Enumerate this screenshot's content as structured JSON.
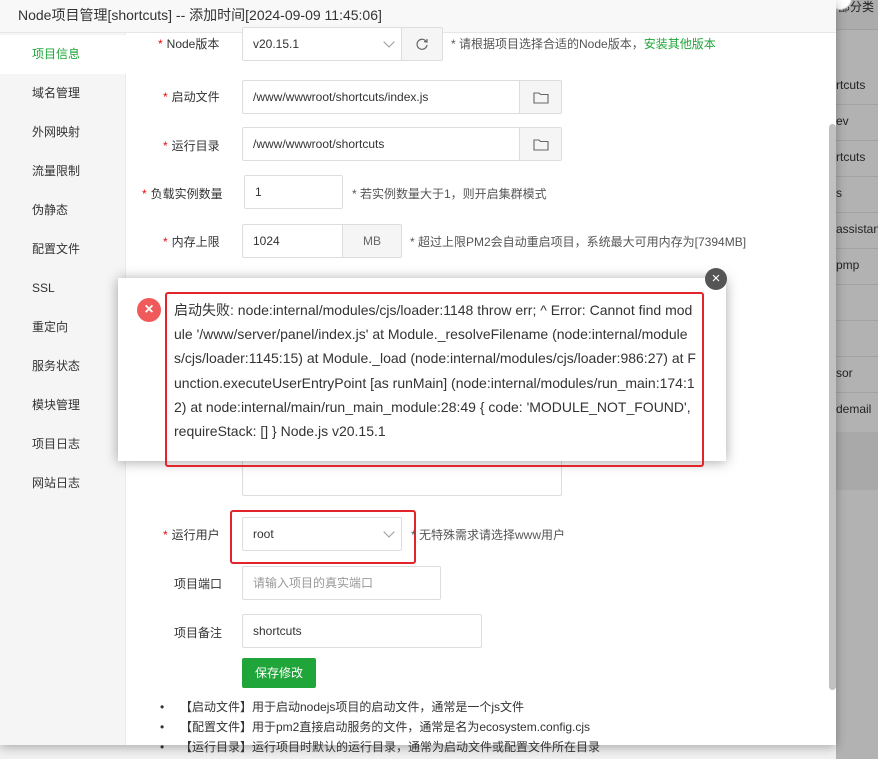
{
  "background": {
    "right_items": [
      "rtcuts",
      "ev",
      "rtcuts",
      "s",
      "assistan",
      "pmp",
      "sor",
      "demail"
    ],
    "top_label": "部分类"
  },
  "modal": {
    "title": "Node项目管理[shortcuts] -- 添加时间[2024-09-09 11:45:06]"
  },
  "sidebar": {
    "items": [
      {
        "label": "项目信息",
        "active": true
      },
      {
        "label": "域名管理"
      },
      {
        "label": "外网映射"
      },
      {
        "label": "流量限制"
      },
      {
        "label": "伪静态"
      },
      {
        "label": "配置文件"
      },
      {
        "label": "SSL"
      },
      {
        "label": "重定向"
      },
      {
        "label": "服务状态"
      },
      {
        "label": "模块管理"
      },
      {
        "label": "项目日志"
      },
      {
        "label": "网站日志"
      }
    ]
  },
  "form": {
    "node_version": {
      "label": "Node版本",
      "value": "v20.15.1",
      "hint": "* 请根据项目选择合适的Node版本，",
      "hint_link": "安装其他版本"
    },
    "start_file": {
      "label": "启动文件",
      "value": "/www/wwwroot/shortcuts/index.js"
    },
    "run_dir": {
      "label": "运行目录",
      "value": "/www/wwwroot/shortcuts"
    },
    "instances": {
      "label": "负载实例数量",
      "value": "1",
      "hint": "* 若实例数量大于1，则开启集群模式"
    },
    "memory": {
      "label": "内存上限",
      "value": "1024",
      "unit": "MB",
      "hint": "* 超过上限PM2会自动重启项目，系统最大可用内存为[7394MB]"
    },
    "run_user": {
      "label": "运行用户",
      "value": "root",
      "hint": "* 无特殊需求请选择www用户"
    },
    "port": {
      "label": "项目端口",
      "placeholder": "请输入项目的真实端口"
    },
    "remark": {
      "label": "项目备注",
      "value": "shortcuts"
    },
    "save_label": "保存修改"
  },
  "tips": [
    "【启动文件】用于启动nodejs项目的启动文件，通常是一个js文件",
    "【配置文件】用于pm2直接启动服务的文件，通常是名为ecosystem.config.cjs",
    "【运行目录】运行项目时默认的运行目录，通常为启动文件或配置文件所在目录"
  ],
  "error": {
    "message": "启动失败: node:internal/modules/cjs/loader:1148 throw err; ^ Error: Cannot find module '/www/server/panel/index.js' at Module._resolveFilename (node:internal/modules/cjs/loader:1145:15) at Module._load (node:internal/modules/cjs/loader:986:27) at Function.executeUserEntryPoint [as runMain] (node:internal/modules/run_main:174:12) at node:internal/main/run_main_module:28:49 { code: 'MODULE_NOT_FOUND', requireStack: [] } Node.js v20.15.1"
  },
  "colors": {
    "accent": "#20a53a",
    "error": "#f05a5a",
    "highlight": "#e3242b"
  }
}
